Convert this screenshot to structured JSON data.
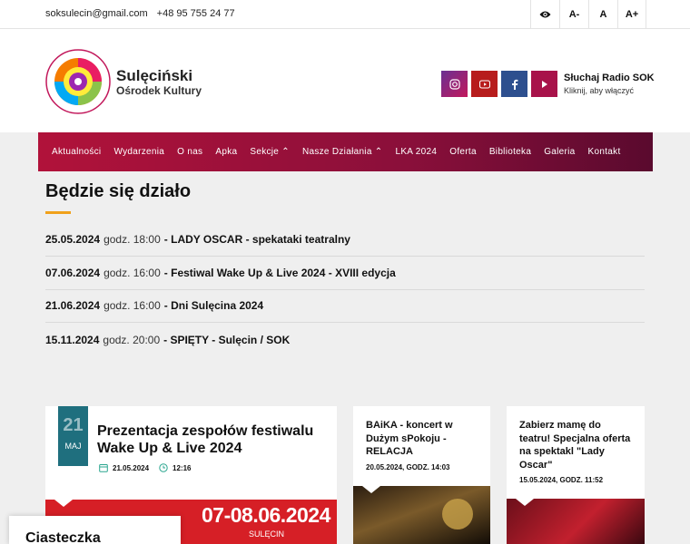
{
  "topbar": {
    "email": "soksulecin@gmail.com",
    "phone": "+48 95 755 24 77",
    "font_small": "A-",
    "font_normal": "A",
    "font_large": "A+"
  },
  "brand": {
    "line1": "Sulęciński",
    "line2": "Ośrodek Kultury"
  },
  "radio": {
    "title": "Słuchaj Radio SOK",
    "subtitle": "Kliknij, aby włączyć"
  },
  "nav": [
    "Aktualności",
    "Wydarzenia",
    "O nas",
    "Apka",
    "Sekcje ⌃",
    "Nasze Działania ⌃",
    "LKA 2024",
    "Oferta",
    "Biblioteka",
    "Galeria",
    "Kontakt"
  ],
  "events": {
    "heading": "Będzie się działo",
    "items": [
      {
        "date": "25.05.2024",
        "time": "godz. 18:00",
        "title": "- LADY OSCAR - spekataki teatralny"
      },
      {
        "date": "07.06.2024",
        "time": "godz. 16:00",
        "title": "- Festiwal Wake Up & Live 2024 - XVIII edycja"
      },
      {
        "date": "21.06.2024",
        "time": "godz. 16:00",
        "title": "- Dni Sulęcina 2024"
      },
      {
        "date": "15.11.2024",
        "time": "godz. 20:00",
        "title": "- SPIĘTY - Sulęcin / SOK"
      }
    ]
  },
  "featured": {
    "day": "21",
    "month": "MAJ",
    "title": "Prezentacja zespołów festiwalu Wake Up & Live 2024",
    "date": "21.05.2024",
    "time": "12:16",
    "banner": "07-08.06.2024",
    "banner_place": "SULĘCIN"
  },
  "cards": [
    {
      "title": "BAiKA - koncert w Dużym sPokoju - RELACJA",
      "meta": "20.05.2024, GODZ. 14:03"
    },
    {
      "title": "Zabierz mamę do teatru! Specjalna oferta na spektakl \"Lady Oscar\"",
      "meta": "15.05.2024, GODZ. 11:52"
    }
  ],
  "cookie": {
    "title": "Ciasteczka"
  },
  "colors": {
    "accent": "#f0a11b",
    "nav_start": "#b1123a",
    "nav_end": "#5a0a2e",
    "date_box": "#1f6f7e"
  }
}
